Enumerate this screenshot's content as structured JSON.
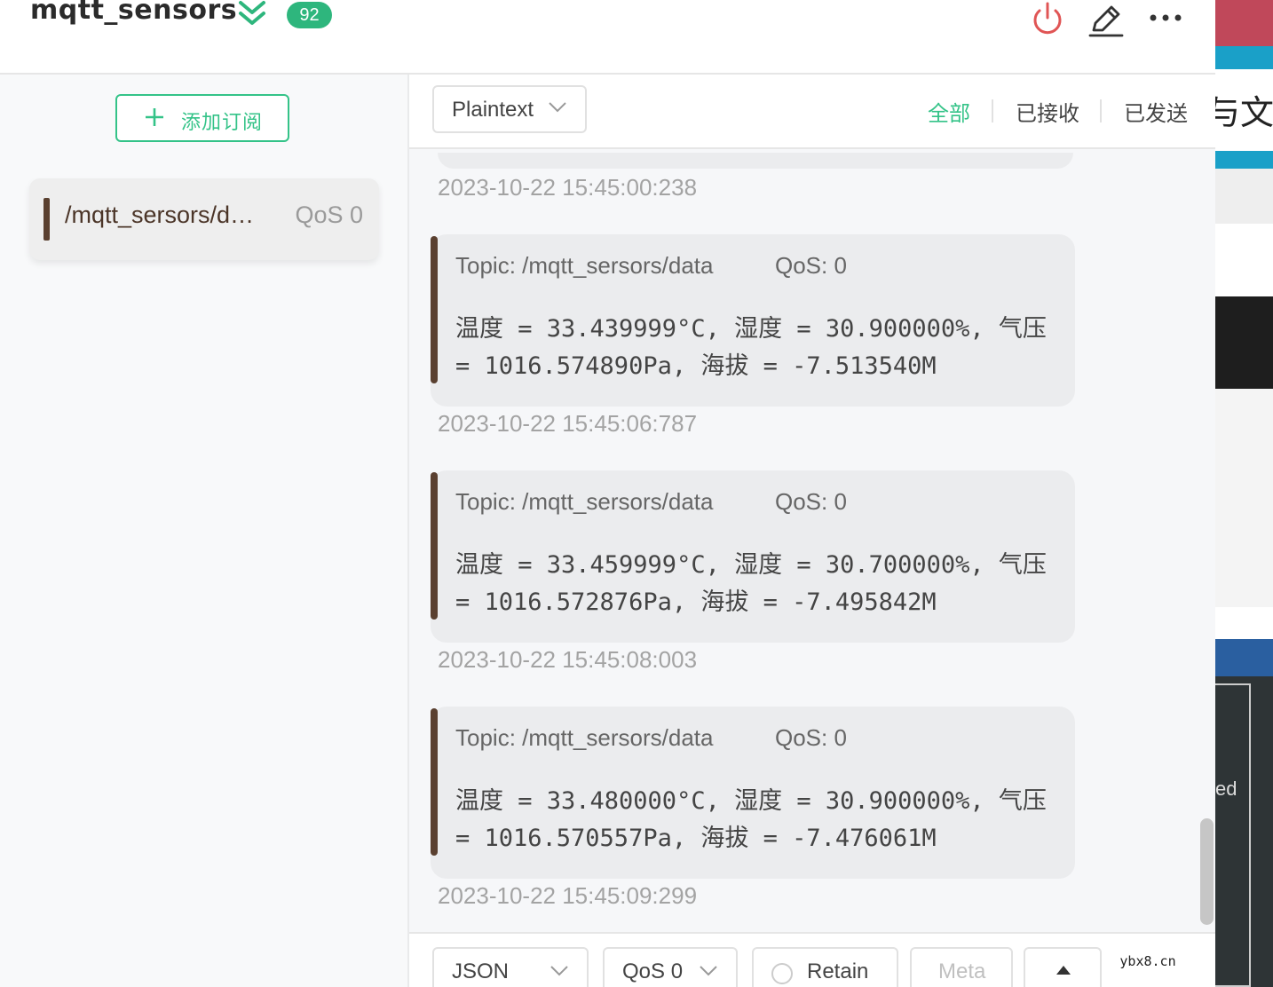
{
  "header": {
    "connection_name": "mqtt_sensors",
    "message_count": "92",
    "icons": [
      "chevrons-down-icon",
      "power-icon",
      "edit-icon",
      "more-icon"
    ]
  },
  "sidebar": {
    "add_subscription_label": "添加订阅",
    "subscriptions": [
      {
        "topic": "/mqtt_sersors/d…",
        "qos": "QoS 0",
        "color": "#5a4030"
      }
    ]
  },
  "toolbar": {
    "format_select": "Plaintext",
    "filters": {
      "all": "全部",
      "received": "已接收",
      "sent": "已发送"
    },
    "active_filter": "all"
  },
  "messages": {
    "first_time": "2023-10-22 15:45:00:238",
    "items": [
      {
        "topic": "Topic: /mqtt_sersors/data",
        "qos": "QoS: 0",
        "payload": "温度 = 33.439999°C, 湿度 = 30.900000%, 气压 = 1016.574890Pa, 海拔 = -7.513540M",
        "time": "2023-10-22 15:45:06:787"
      },
      {
        "topic": "Topic: /mqtt_sersors/data",
        "qos": "QoS: 0",
        "payload": "温度 = 33.459999°C, 湿度 = 30.700000%, 气压 = 1016.572876Pa, 海拔 = -7.495842M",
        "time": "2023-10-22 15:45:08:003"
      },
      {
        "topic": "Topic: /mqtt_sersors/data",
        "qos": "QoS: 0",
        "payload": "温度 = 33.480000°C, 湿度 = 30.900000%, 气压 = 1016.570557Pa, 海拔 = -7.476061M",
        "time": "2023-10-22 15:45:09:299"
      }
    ]
  },
  "input_bar": {
    "payload_format": "JSON",
    "qos": "QoS 0",
    "retain_label": "Retain",
    "meta_label": "Meta"
  },
  "background": {
    "partial_text": "与文章",
    "partial_text_2": "ed"
  },
  "watermark": "ybx8.cn",
  "colors": {
    "accent": "#34c388",
    "badge": "#2eb67d",
    "power_icon": "#e05555",
    "topic_bar": "#5a4030"
  }
}
